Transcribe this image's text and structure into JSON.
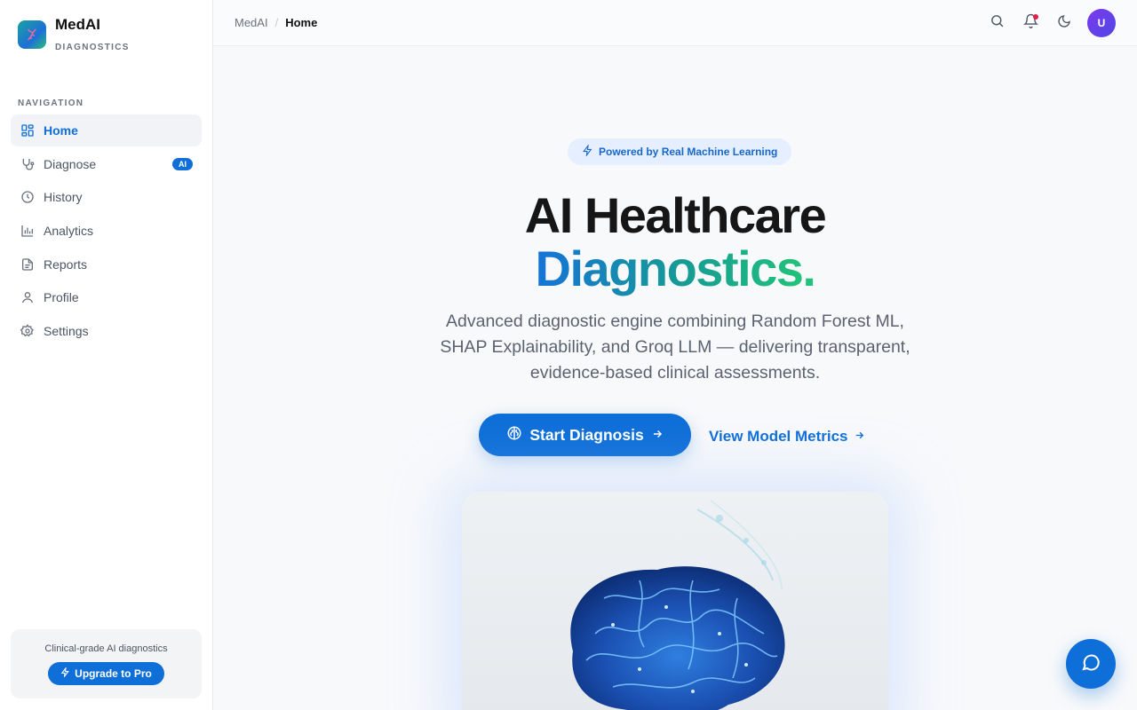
{
  "brand": {
    "name": "MedAI",
    "subtitle": "DIAGNOSTICS"
  },
  "nav": {
    "heading": "NAVIGATION",
    "items": [
      {
        "label": "Home",
        "icon": "grid-icon",
        "active": true
      },
      {
        "label": "Diagnose",
        "icon": "stethoscope-icon",
        "badge": "AI"
      },
      {
        "label": "History",
        "icon": "clock-icon"
      },
      {
        "label": "Analytics",
        "icon": "bar-chart-icon"
      },
      {
        "label": "Reports",
        "icon": "document-icon"
      },
      {
        "label": "Profile",
        "icon": "user-icon"
      },
      {
        "label": "Settings",
        "icon": "gear-icon"
      }
    ]
  },
  "upgrade": {
    "text": "Clinical-grade AI diagnostics",
    "button": "Upgrade to Pro"
  },
  "header": {
    "breadcrumb": [
      "MedAI",
      "Home"
    ],
    "avatar_initial": "U"
  },
  "hero": {
    "pill": "Powered by Real Machine Learning",
    "title_line1": "AI Healthcare",
    "title_line2": "Diagnostics",
    "title_dot": ".",
    "description": "Advanced diagnostic engine combining Random Forest ML, SHAP Explainability, and Groq LLM — delivering transparent, evidence-based clinical assessments.",
    "primary_cta": "Start Diagnosis",
    "secondary_cta": "View Model Metrics"
  },
  "colors": {
    "accent": "#0f6fd8",
    "gradient_start": "#1573d8",
    "gradient_end": "#22c27a",
    "notification": "#e11d48"
  }
}
